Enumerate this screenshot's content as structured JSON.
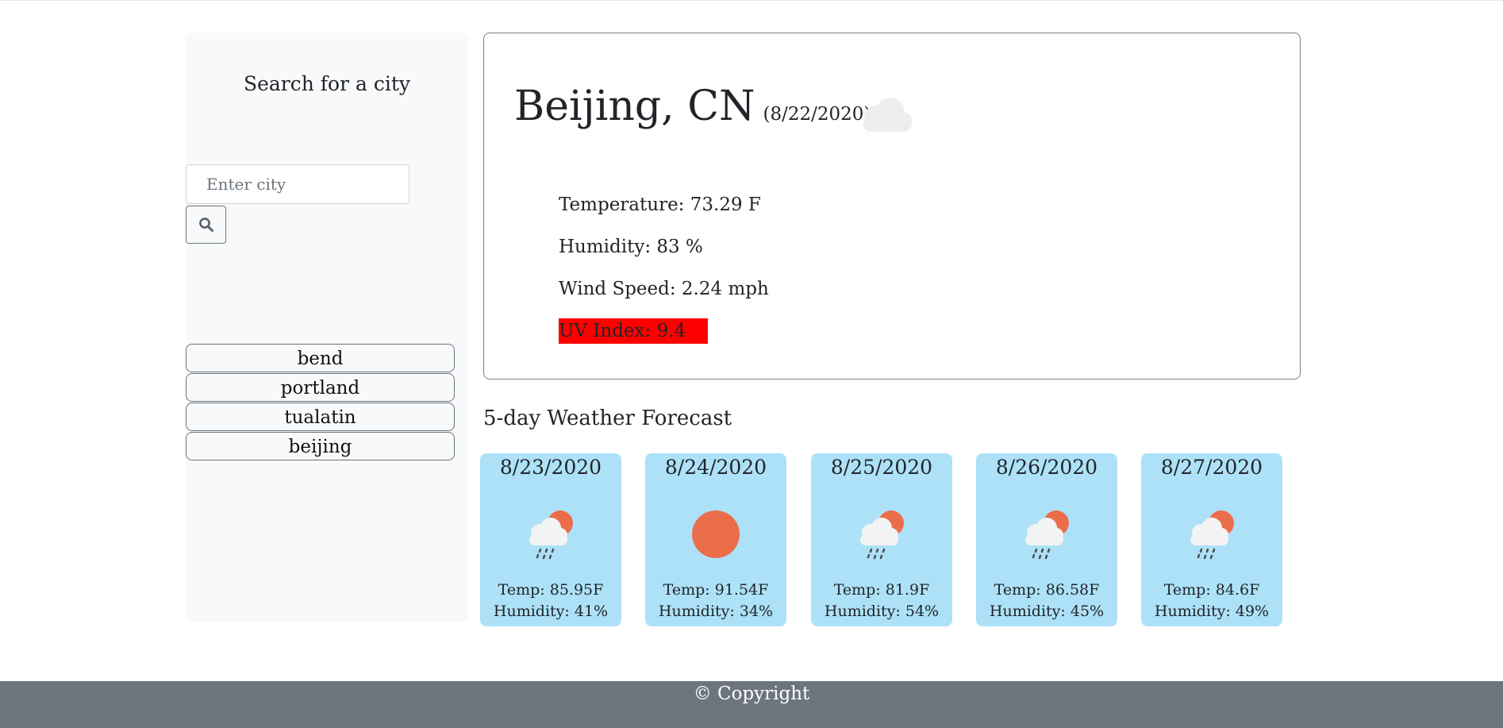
{
  "sidebar": {
    "title": "Search for a city",
    "search_placeholder": "Enter city",
    "search_button_icon": "search-icon",
    "history": [
      "bend",
      "portland",
      "tualatin",
      "beijing"
    ]
  },
  "current": {
    "city": "Beijing, CN",
    "date": "(8/22/2020)",
    "icon": "cloud-icon",
    "temperature": "Temperature: 73.29 F",
    "humidity": "Humidity: 83 %",
    "wind_speed": "Wind Speed: 2.24 mph",
    "uv_index": "UV Index: 9.4",
    "uv_color": "#ff0000"
  },
  "forecast": {
    "title": "5-day Weather Forecast",
    "card_color": "#ade1f8",
    "days": [
      {
        "date": "8/23/2020",
        "icon": "rain-sun-icon",
        "temp": "Temp: 85.95F",
        "humidity": "Humidity: 41%"
      },
      {
        "date": "8/24/2020",
        "icon": "sun-icon",
        "temp": "Temp: 91.54F",
        "humidity": "Humidity: 34%"
      },
      {
        "date": "8/25/2020",
        "icon": "rain-sun-icon",
        "temp": "Temp: 81.9F",
        "humidity": "Humidity: 54%"
      },
      {
        "date": "8/26/2020",
        "icon": "rain-sun-icon",
        "temp": "Temp: 86.58F",
        "humidity": "Humidity: 45%"
      },
      {
        "date": "8/27/2020",
        "icon": "rain-sun-icon",
        "temp": "Temp: 84.6F",
        "humidity": "Humidity: 49%"
      }
    ]
  },
  "footer": {
    "text": "© Copyright",
    "background": "#6c757d"
  }
}
